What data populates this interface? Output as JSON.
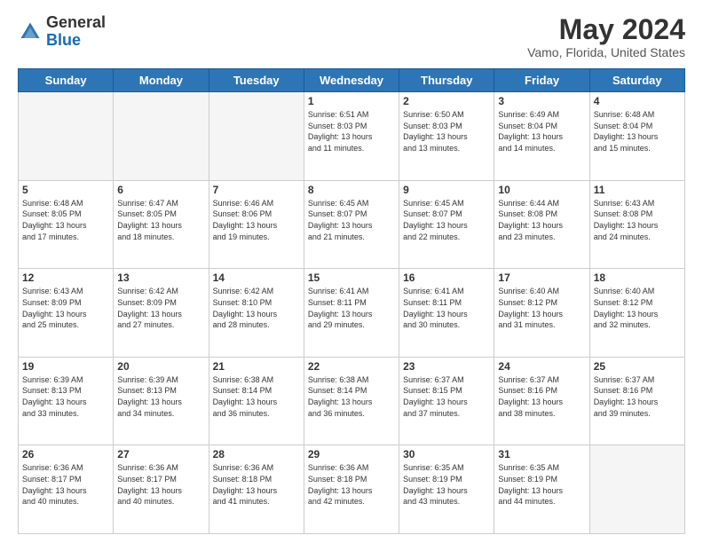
{
  "header": {
    "logo_general": "General",
    "logo_blue": "Blue",
    "month_title": "May 2024",
    "location": "Vamo, Florida, United States"
  },
  "days_of_week": [
    "Sunday",
    "Monday",
    "Tuesday",
    "Wednesday",
    "Thursday",
    "Friday",
    "Saturday"
  ],
  "weeks": [
    [
      {
        "day": "",
        "info": "",
        "empty": true
      },
      {
        "day": "",
        "info": "",
        "empty": true
      },
      {
        "day": "",
        "info": "",
        "empty": true
      },
      {
        "day": "1",
        "info": "Sunrise: 6:51 AM\nSunset: 8:03 PM\nDaylight: 13 hours\nand 11 minutes.",
        "empty": false
      },
      {
        "day": "2",
        "info": "Sunrise: 6:50 AM\nSunset: 8:03 PM\nDaylight: 13 hours\nand 13 minutes.",
        "empty": false
      },
      {
        "day": "3",
        "info": "Sunrise: 6:49 AM\nSunset: 8:04 PM\nDaylight: 13 hours\nand 14 minutes.",
        "empty": false
      },
      {
        "day": "4",
        "info": "Sunrise: 6:48 AM\nSunset: 8:04 PM\nDaylight: 13 hours\nand 15 minutes.",
        "empty": false
      }
    ],
    [
      {
        "day": "5",
        "info": "Sunrise: 6:48 AM\nSunset: 8:05 PM\nDaylight: 13 hours\nand 17 minutes.",
        "empty": false
      },
      {
        "day": "6",
        "info": "Sunrise: 6:47 AM\nSunset: 8:05 PM\nDaylight: 13 hours\nand 18 minutes.",
        "empty": false
      },
      {
        "day": "7",
        "info": "Sunrise: 6:46 AM\nSunset: 8:06 PM\nDaylight: 13 hours\nand 19 minutes.",
        "empty": false
      },
      {
        "day": "8",
        "info": "Sunrise: 6:45 AM\nSunset: 8:07 PM\nDaylight: 13 hours\nand 21 minutes.",
        "empty": false
      },
      {
        "day": "9",
        "info": "Sunrise: 6:45 AM\nSunset: 8:07 PM\nDaylight: 13 hours\nand 22 minutes.",
        "empty": false
      },
      {
        "day": "10",
        "info": "Sunrise: 6:44 AM\nSunset: 8:08 PM\nDaylight: 13 hours\nand 23 minutes.",
        "empty": false
      },
      {
        "day": "11",
        "info": "Sunrise: 6:43 AM\nSunset: 8:08 PM\nDaylight: 13 hours\nand 24 minutes.",
        "empty": false
      }
    ],
    [
      {
        "day": "12",
        "info": "Sunrise: 6:43 AM\nSunset: 8:09 PM\nDaylight: 13 hours\nand 25 minutes.",
        "empty": false
      },
      {
        "day": "13",
        "info": "Sunrise: 6:42 AM\nSunset: 8:09 PM\nDaylight: 13 hours\nand 27 minutes.",
        "empty": false
      },
      {
        "day": "14",
        "info": "Sunrise: 6:42 AM\nSunset: 8:10 PM\nDaylight: 13 hours\nand 28 minutes.",
        "empty": false
      },
      {
        "day": "15",
        "info": "Sunrise: 6:41 AM\nSunset: 8:11 PM\nDaylight: 13 hours\nand 29 minutes.",
        "empty": false
      },
      {
        "day": "16",
        "info": "Sunrise: 6:41 AM\nSunset: 8:11 PM\nDaylight: 13 hours\nand 30 minutes.",
        "empty": false
      },
      {
        "day": "17",
        "info": "Sunrise: 6:40 AM\nSunset: 8:12 PM\nDaylight: 13 hours\nand 31 minutes.",
        "empty": false
      },
      {
        "day": "18",
        "info": "Sunrise: 6:40 AM\nSunset: 8:12 PM\nDaylight: 13 hours\nand 32 minutes.",
        "empty": false
      }
    ],
    [
      {
        "day": "19",
        "info": "Sunrise: 6:39 AM\nSunset: 8:13 PM\nDaylight: 13 hours\nand 33 minutes.",
        "empty": false
      },
      {
        "day": "20",
        "info": "Sunrise: 6:39 AM\nSunset: 8:13 PM\nDaylight: 13 hours\nand 34 minutes.",
        "empty": false
      },
      {
        "day": "21",
        "info": "Sunrise: 6:38 AM\nSunset: 8:14 PM\nDaylight: 13 hours\nand 36 minutes.",
        "empty": false
      },
      {
        "day": "22",
        "info": "Sunrise: 6:38 AM\nSunset: 8:14 PM\nDaylight: 13 hours\nand 36 minutes.",
        "empty": false
      },
      {
        "day": "23",
        "info": "Sunrise: 6:37 AM\nSunset: 8:15 PM\nDaylight: 13 hours\nand 37 minutes.",
        "empty": false
      },
      {
        "day": "24",
        "info": "Sunrise: 6:37 AM\nSunset: 8:16 PM\nDaylight: 13 hours\nand 38 minutes.",
        "empty": false
      },
      {
        "day": "25",
        "info": "Sunrise: 6:37 AM\nSunset: 8:16 PM\nDaylight: 13 hours\nand 39 minutes.",
        "empty": false
      }
    ],
    [
      {
        "day": "26",
        "info": "Sunrise: 6:36 AM\nSunset: 8:17 PM\nDaylight: 13 hours\nand 40 minutes.",
        "empty": false
      },
      {
        "day": "27",
        "info": "Sunrise: 6:36 AM\nSunset: 8:17 PM\nDaylight: 13 hours\nand 40 minutes.",
        "empty": false
      },
      {
        "day": "28",
        "info": "Sunrise: 6:36 AM\nSunset: 8:18 PM\nDaylight: 13 hours\nand 41 minutes.",
        "empty": false
      },
      {
        "day": "29",
        "info": "Sunrise: 6:36 AM\nSunset: 8:18 PM\nDaylight: 13 hours\nand 42 minutes.",
        "empty": false
      },
      {
        "day": "30",
        "info": "Sunrise: 6:35 AM\nSunset: 8:19 PM\nDaylight: 13 hours\nand 43 minutes.",
        "empty": false
      },
      {
        "day": "31",
        "info": "Sunrise: 6:35 AM\nSunset: 8:19 PM\nDaylight: 13 hours\nand 44 minutes.",
        "empty": false
      },
      {
        "day": "",
        "info": "",
        "empty": true
      }
    ]
  ]
}
